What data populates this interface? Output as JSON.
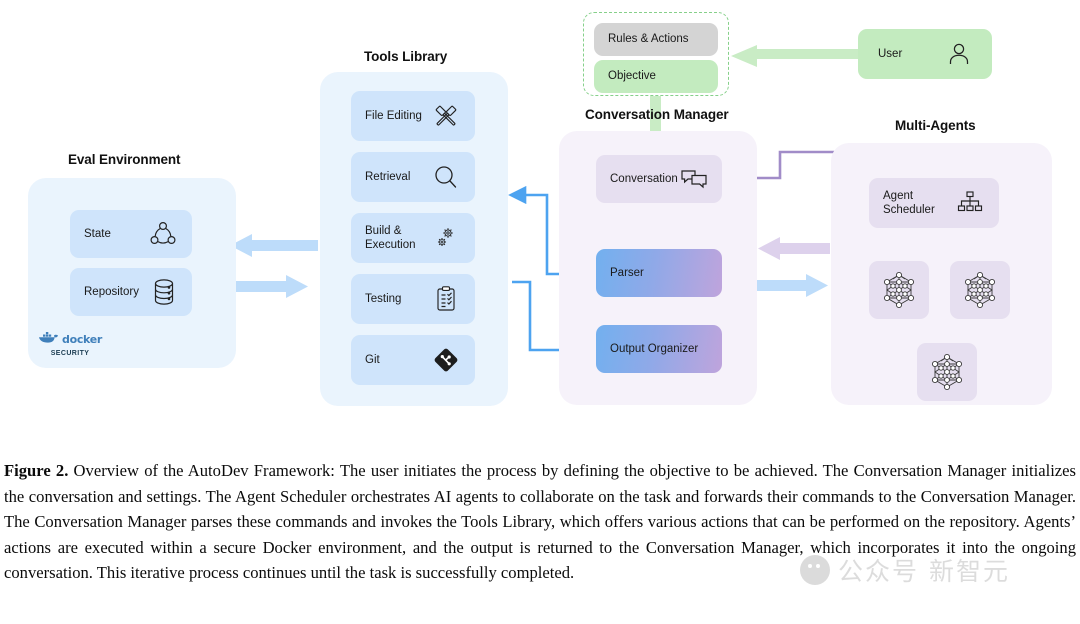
{
  "figure": {
    "sections": {
      "eval_environment": {
        "title": "Eval Environment",
        "cards": [
          {
            "label": "State",
            "icon": "state-graph-icon"
          },
          {
            "label": "Repository",
            "icon": "database-icon"
          }
        ],
        "badge": {
          "word": "docker",
          "sub": "SECURITY",
          "icon": "docker-whale-icon"
        }
      },
      "tools_library": {
        "title": "Tools Library",
        "cards": [
          {
            "label": "File Editing",
            "icon": "hammer-tools-icon"
          },
          {
            "label": "Retrieval",
            "icon": "magnifier-icon"
          },
          {
            "label": "Build &\nExecution",
            "icon": "gears-icon"
          },
          {
            "label": "Testing",
            "icon": "clipboard-checklist-icon"
          },
          {
            "label": "Git",
            "icon": "git-icon"
          }
        ]
      },
      "conversation_manager": {
        "title": "Conversation Manager",
        "cards": [
          {
            "label": "Conversation",
            "icon": "chat-bubbles-icon"
          },
          {
            "label": "Parser",
            "icon": ""
          },
          {
            "label": "Output Organizer",
            "icon": ""
          }
        ]
      },
      "multi_agents": {
        "title": "Multi-Agents",
        "cards": [
          {
            "label": "Agent\nScheduler",
            "icon": "hierarchy-icon"
          },
          {
            "label": "",
            "icon": "neural-network-icon"
          },
          {
            "label": "",
            "icon": "neural-network-icon"
          },
          {
            "label": "",
            "icon": "neural-network-icon"
          }
        ]
      },
      "input_group": {
        "cards": [
          {
            "label": "Rules & Actions",
            "style": "grey"
          },
          {
            "label": "Objective",
            "style": "green"
          }
        ]
      },
      "user": {
        "label": "User",
        "icon": "user-person-icon"
      }
    },
    "colors": {
      "panel_blue": "#eaf4fd",
      "panel_purple": "#f6f2fa",
      "card_blue": "#cfe4fb",
      "card_purple": "#e6dff0",
      "card_grey": "#d4d4d4",
      "card_green": "#c3ebbf",
      "arrow_blue": "#bddcfa",
      "arrow_purple": "#ddd1ec",
      "arrow_green": "#c9ecc5",
      "line_blue": "#4da3f0",
      "line_purple": "#a18cc8"
    }
  },
  "caption": {
    "label": "Figure 2.",
    "text": " Overview of the AutoDev Framework: The user initiates the process by defining the objective to be achieved. The Conversation Manager initializes the conversation and settings. The Agent Scheduler orchestrates AI agents to collaborate on the task and forwards their commands to the Conversation Manager. The Conversation Manager parses these commands and invokes the Tools Library, which offers various actions that can be performed on the repository. Agents’ actions are executed within a secure Docker environment, and the output is returned to the Conversation Manager, which incorporates it into the ongoing conversation. This iterative process continues until the task is successfully completed."
  },
  "watermark": {
    "text": "公众号 新智元"
  }
}
